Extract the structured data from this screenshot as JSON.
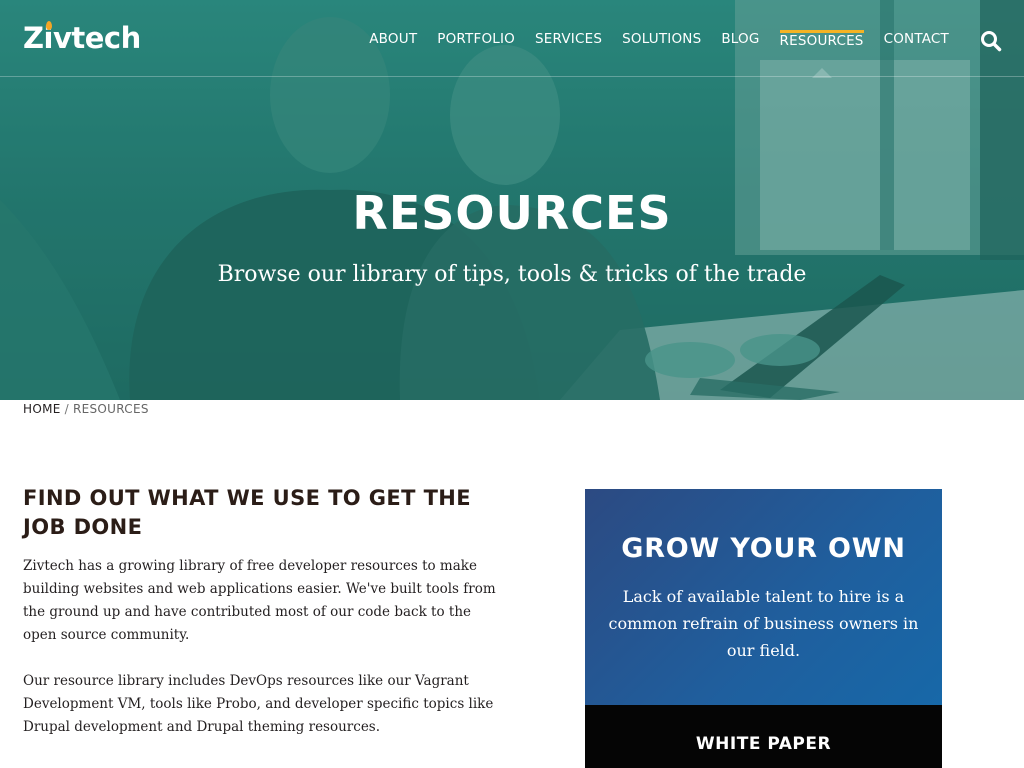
{
  "header": {
    "logo": "Zivtech",
    "nav": [
      {
        "label": "ABOUT"
      },
      {
        "label": "PORTFOLIO"
      },
      {
        "label": "SERVICES"
      },
      {
        "label": "SOLUTIONS"
      },
      {
        "label": "BLOG"
      },
      {
        "label": "RESOURCES",
        "active": true
      },
      {
        "label": "CONTACT"
      }
    ],
    "search_icon": "search-icon"
  },
  "hero": {
    "title": "RESOURCES",
    "subtitle": "Browse our library of tips, tools & tricks of the trade"
  },
  "breadcrumb": {
    "home": "HOME",
    "separator": "/",
    "current": "RESOURCES"
  },
  "main": {
    "heading": "FIND OUT WHAT WE USE TO GET THE JOB DONE",
    "paragraphs": [
      "Zivtech has a growing library of free developer resources to make building websites and web applications easier. We've built tools from the ground up and have contributed most of our code back to the open source community.",
      "Our resource library includes DevOps resources like our Vagrant Development VM, tools like Probo, and developer specific topics like Drupal development and Drupal theming resources."
    ]
  },
  "promo": {
    "title": "GROW YOUR OWN",
    "text": "Lack of available talent to hire is a common refrain of business owners in our field.",
    "footer_label": "WHITE PAPER"
  },
  "colors": {
    "hero_teal": "#267a72",
    "nav_active_underline": "#f5b324",
    "logo_accent": "#f5a524",
    "promo_blue": "#1f5f9e",
    "promo_footer": "#050505"
  }
}
